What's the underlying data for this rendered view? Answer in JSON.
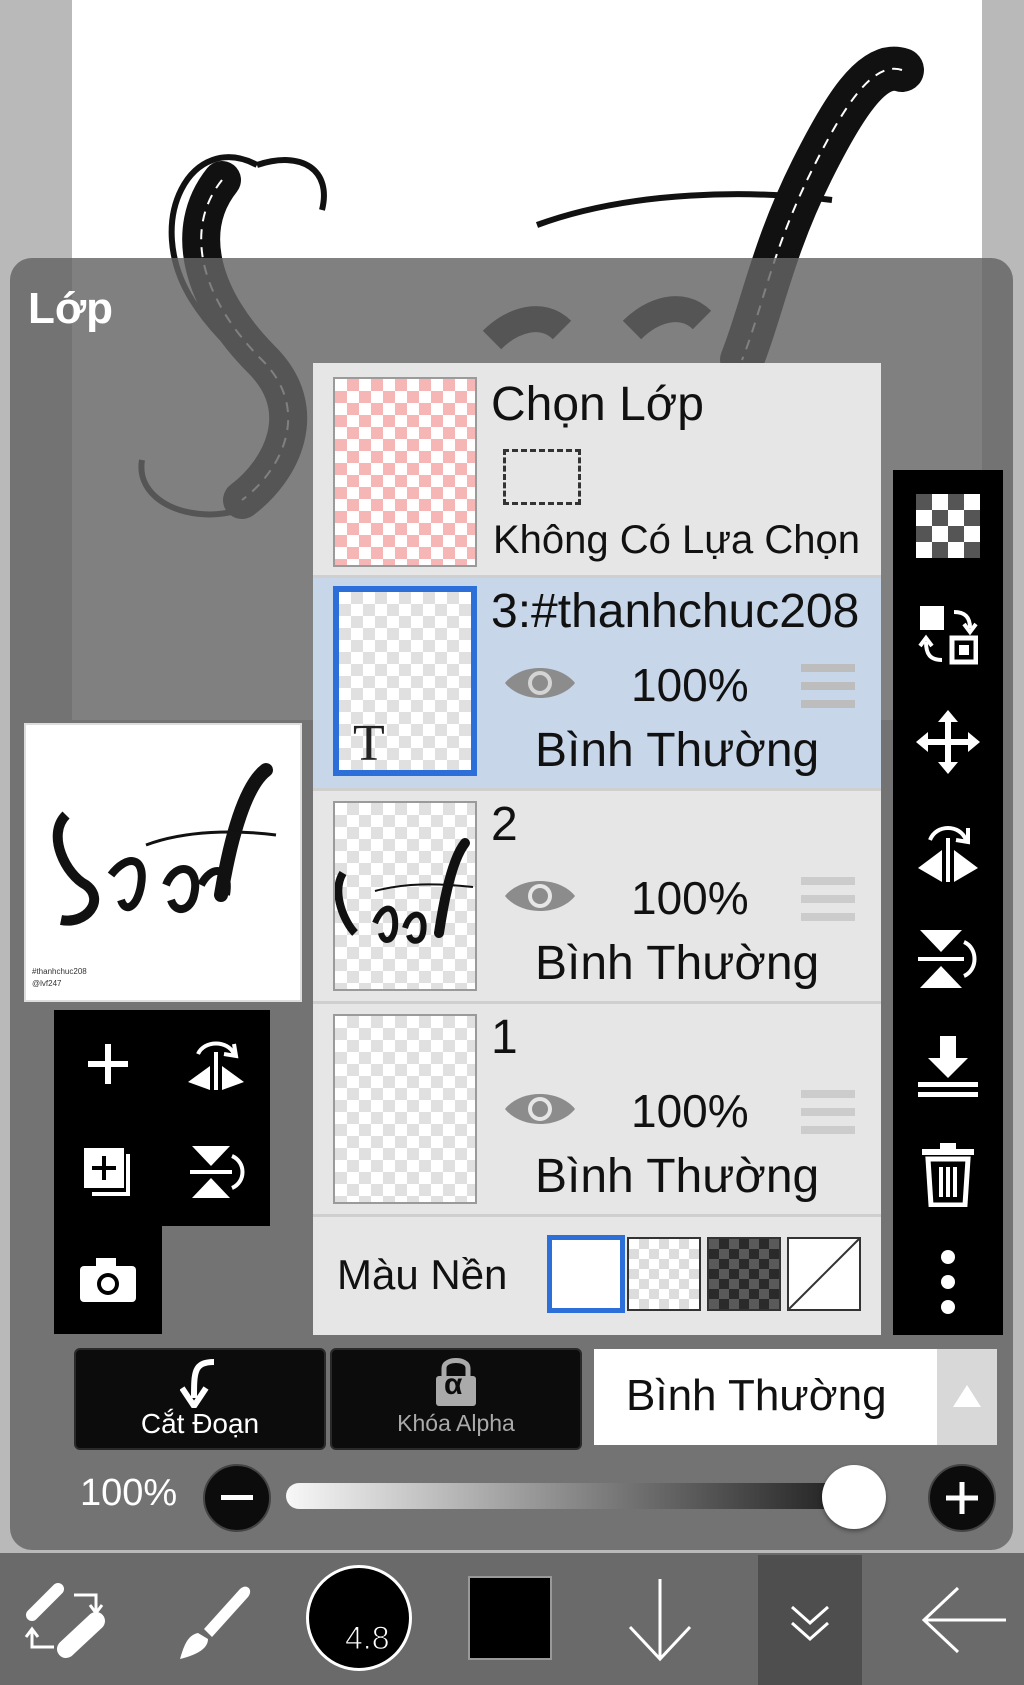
{
  "panel": {
    "title": "Lớp"
  },
  "layers": {
    "selection": {
      "title": "Chọn Lớp",
      "status": "Không Có Lựa Chọn"
    },
    "rows": [
      {
        "name": "3:#thanhchuc208",
        "opacity": "100%",
        "blend": "Bình Thường",
        "thumb_glyph": "T"
      },
      {
        "name": "2",
        "opacity": "100%",
        "blend": "Bình Thường"
      },
      {
        "name": "1",
        "opacity": "100%",
        "blend": "Bình Thường"
      }
    ],
    "background_label": "Màu Nền"
  },
  "preview": {
    "caption_1": "#thanhchuc208",
    "caption_2": "@lvf247"
  },
  "controls": {
    "clip_label": "Cắt Đoạn",
    "alpha_lock_label": "Khóa Alpha",
    "alpha_glyph": "α",
    "blend_mode": "Bình Thường",
    "opacity_label": "100%",
    "opacity_value": 1.0
  },
  "toolbar": {
    "brush_size": "4.8"
  },
  "colors": {
    "accent": "#2c6fd9",
    "selected_row": "#c8d6ea",
    "primary_color": "#000000"
  }
}
